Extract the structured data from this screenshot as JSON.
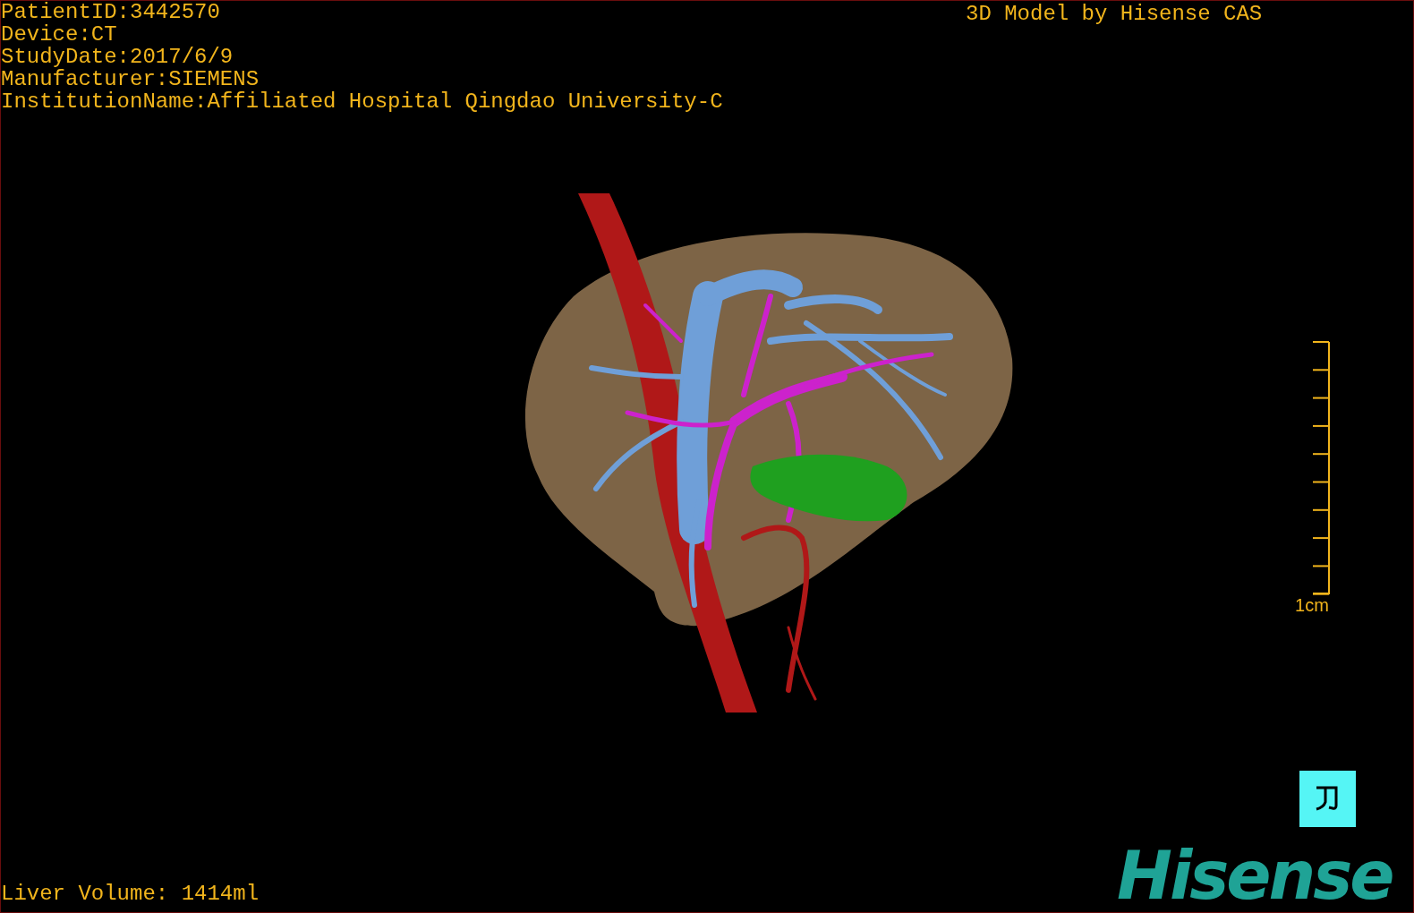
{
  "info_lines": [
    "PatientID:3442570",
    "Device:CT",
    "StudyDate:2017/6/9",
    "Manufacturer:SIEMENS",
    "InstitutionName:Affiliated Hospital Qingdao University-C"
  ],
  "model_caption": "3D Model by Hisense CAS",
  "scale_bar": {
    "label": "1cm"
  },
  "liver_volume": "Liver Volume: 1414ml",
  "logo": "Hisense"
}
